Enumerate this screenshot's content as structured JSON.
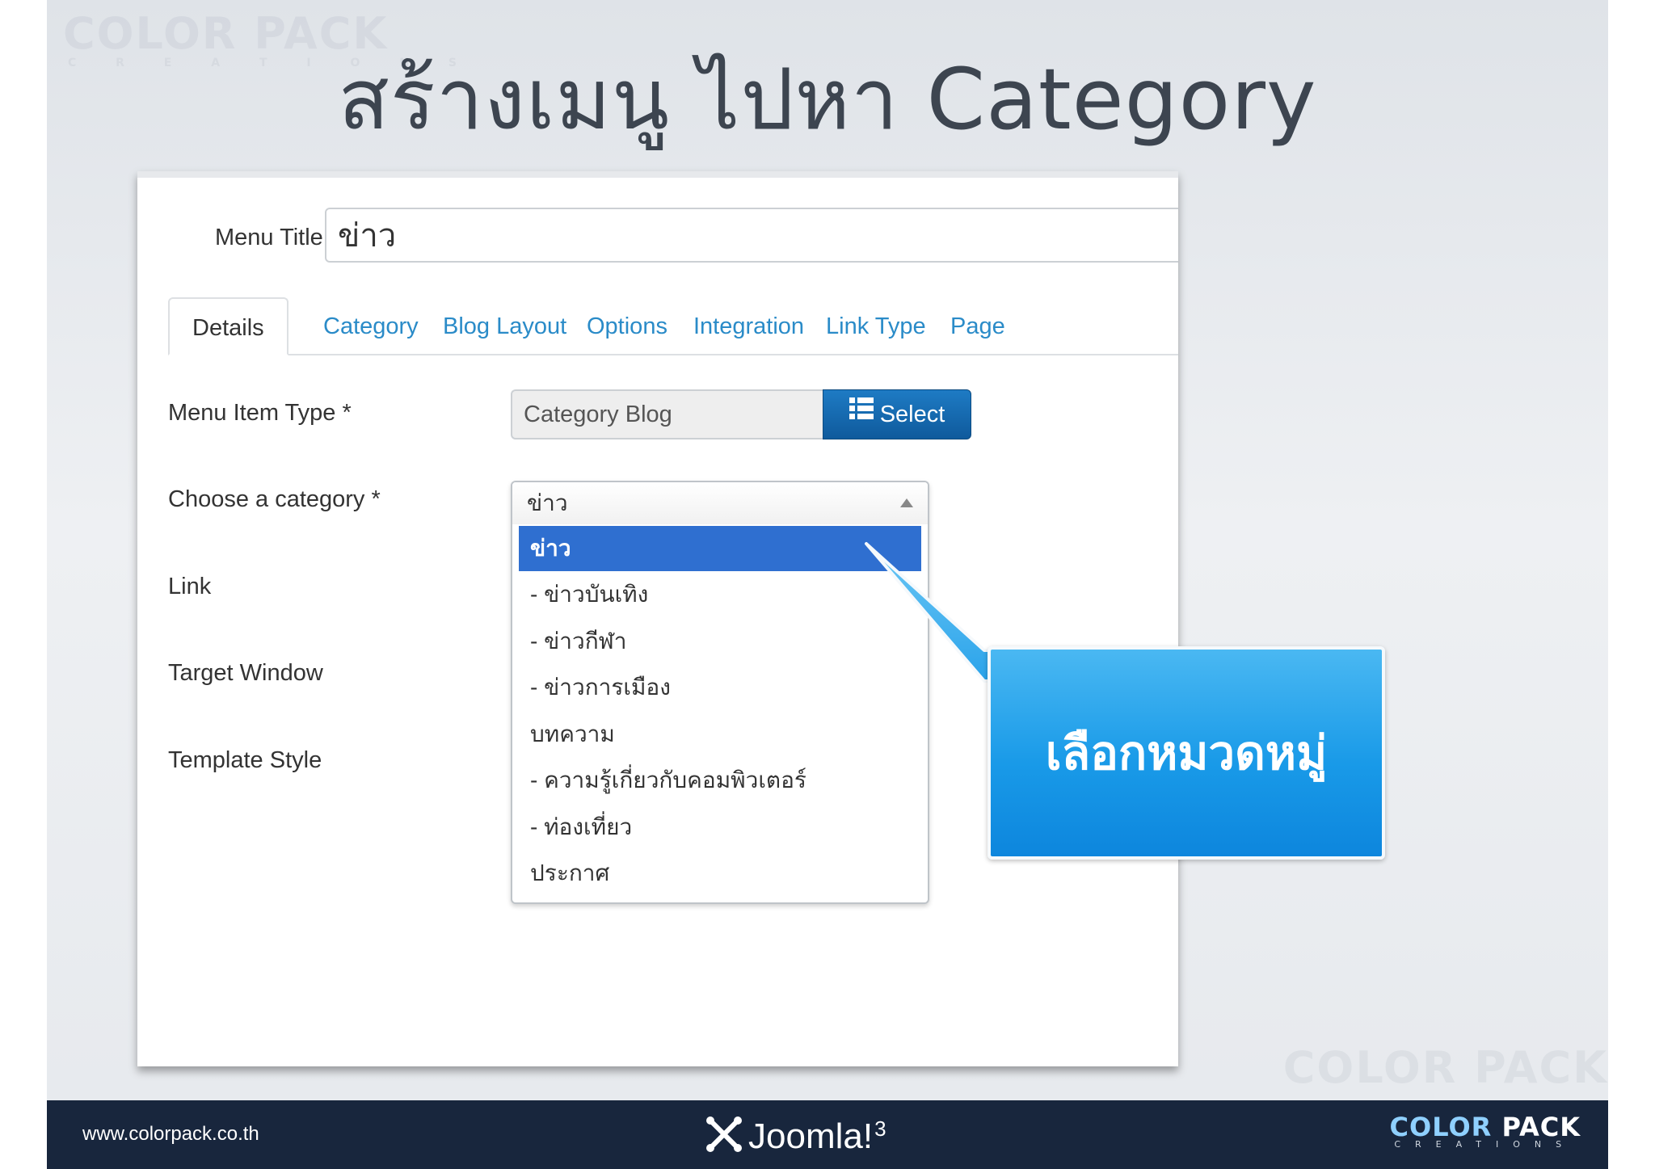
{
  "slide": {
    "title": "สร้างเมนู ไปหา Category",
    "watermark": "COLOR PACK",
    "watermark_sub": "C R E A T I O N S"
  },
  "form": {
    "menu_title_label": "Menu Title *",
    "menu_title_value": "ข่าว",
    "tabs": [
      {
        "label": "Details",
        "active": true
      },
      {
        "label": "Category",
        "active": false
      },
      {
        "label": "Blog Layout",
        "active": false
      },
      {
        "label": "Options",
        "active": false
      },
      {
        "label": "Integration",
        "active": false
      },
      {
        "label": "Link Type",
        "active": false
      },
      {
        "label": "Page",
        "active": false
      }
    ],
    "menu_item_type_label": "Menu Item Type *",
    "menu_item_type_value": "Category Blog",
    "select_button_label": "Select",
    "choose_category_label": "Choose a category *",
    "link_label": "Link",
    "target_window_label": "Target Window",
    "template_style_label": "Template Style"
  },
  "category_dropdown": {
    "current_value": "ข่าว",
    "options": [
      {
        "label": "ข่าว",
        "selected": true
      },
      {
        "label": "- ข่าวบันเทิง",
        "selected": false
      },
      {
        "label": "- ข่าวกีฬา",
        "selected": false
      },
      {
        "label": "- ข่าวการเมือง",
        "selected": false
      },
      {
        "label": "บทความ",
        "selected": false
      },
      {
        "label": "- ความรู้เกี่ยวกับคอมพิวเตอร์",
        "selected": false
      },
      {
        "label": "- ท่องเที่ยว",
        "selected": false
      },
      {
        "label": "ประกาศ",
        "selected": false
      }
    ]
  },
  "callout": {
    "text": "เลือกหมวดหมู่"
  },
  "footer": {
    "url": "www.colorpack.co.th",
    "joomla_text": "Joomla!",
    "joomla_version": "3",
    "brand_color": "COLOR",
    "brand_pack": "PACK",
    "brand_sub": "CREATIONS"
  },
  "colors": {
    "accent": "#2a8bc8",
    "select_button": "#1565a8",
    "selected_option": "#2f6fd0",
    "callout": "#199ae8",
    "footer": "#18263d"
  }
}
